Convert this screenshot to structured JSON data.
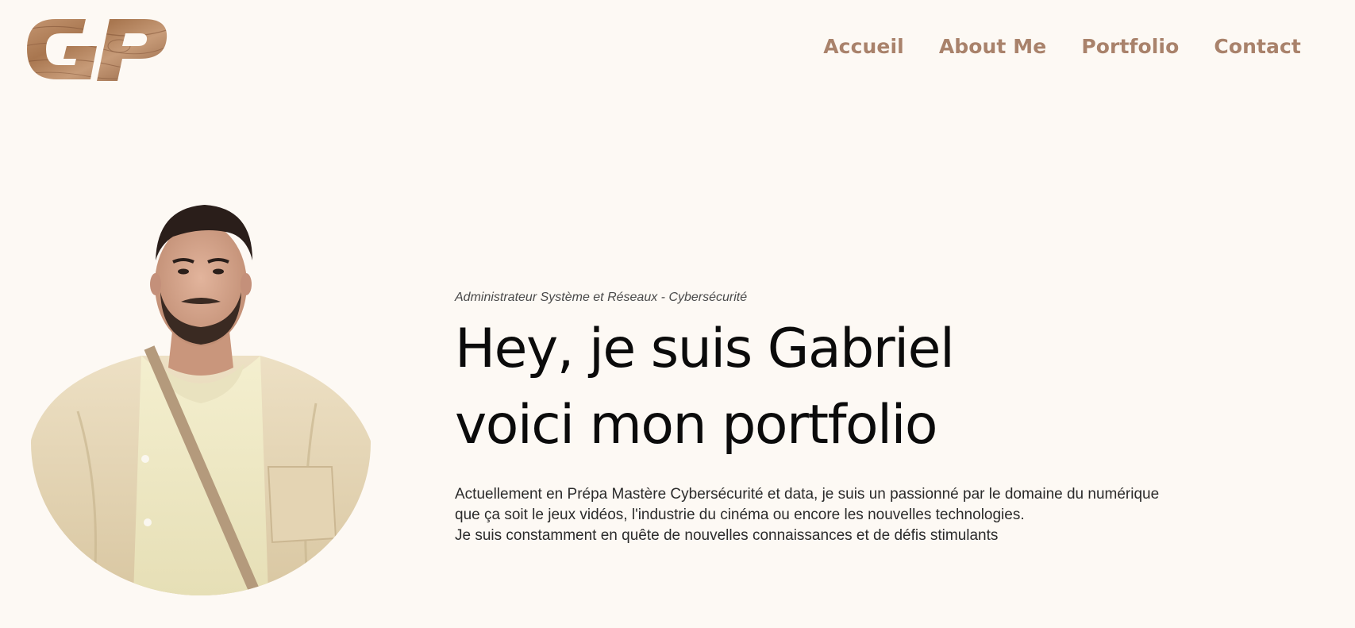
{
  "header": {
    "logo_text": "GP",
    "nav": [
      {
        "label": "Accueil"
      },
      {
        "label": "About Me"
      },
      {
        "label": "Portfolio"
      },
      {
        "label": "Contact"
      }
    ]
  },
  "hero": {
    "subtitle": "Administrateur Système et Réseaux - Cybersécurité",
    "headline_line1": "Hey, je suis Gabriel",
    "headline_line2": "voici mon portfolio",
    "intro_lines": [
      "Actuellement en Prépa Mastère Cybersécurité et data, je suis un passionné par le domaine du numérique",
      "que ça soit le jeux vidéos, l'industrie du cinéma ou encore les nouvelles technologies.",
      "Je suis constamment en quête de nouvelles connaissances et de défis stimulants"
    ]
  },
  "colors": {
    "background": "#fdf9f4",
    "accent": "#a9826b",
    "text": "#0b0b0b",
    "logo_wood": "#9c6a48"
  },
  "icons": {
    "logo": "gp-wood-logo",
    "portrait": "person-photo"
  }
}
